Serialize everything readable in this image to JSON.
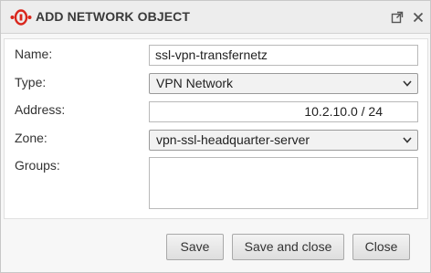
{
  "dialog": {
    "title": "ADD NETWORK OBJECT",
    "icons": [
      "logo-icon",
      "popout-icon",
      "close-icon"
    ]
  },
  "form": {
    "name": {
      "label": "Name:",
      "value": "ssl-vpn-transfernetz"
    },
    "type": {
      "label": "Type:",
      "value": "VPN Network"
    },
    "address": {
      "label": "Address:",
      "value": "10.2.10.0 / 24"
    },
    "zone": {
      "label": "Zone:",
      "value": "vpn-ssl-headquarter-server"
    },
    "groups": {
      "label": "Groups:",
      "value": ""
    }
  },
  "buttons": {
    "save": "Save",
    "save_close": "Save and close",
    "close": "Close"
  },
  "colors": {
    "brand": "#d9261c",
    "titlebar": "#ededed",
    "panel": "#ffffff"
  }
}
